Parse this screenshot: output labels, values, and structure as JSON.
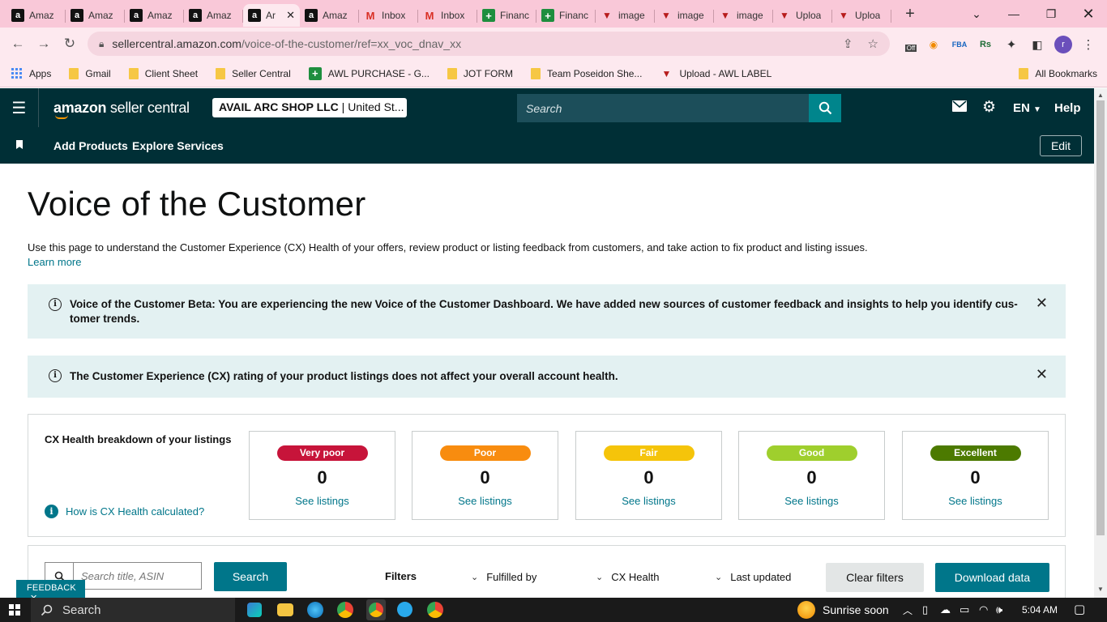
{
  "browser": {
    "tabs": [
      {
        "label": "Amaz",
        "icon": "amazon-icon"
      },
      {
        "label": "Amaz",
        "icon": "amazon-icon"
      },
      {
        "label": "Amaz",
        "icon": "amazon-icon"
      },
      {
        "label": "Amaz",
        "icon": "amazon-icon"
      },
      {
        "label": "Ar",
        "icon": "amazon-icon",
        "active": true
      },
      {
        "label": "Amaz",
        "icon": "amazon-icon"
      },
      {
        "label": "Inbox",
        "icon": "gmail-icon"
      },
      {
        "label": "Inbox",
        "icon": "gmail-icon"
      },
      {
        "label": "Financ",
        "icon": "sheets-icon"
      },
      {
        "label": "Financ",
        "icon": "sheets-icon"
      },
      {
        "label": "image",
        "icon": "triangle-app-icon"
      },
      {
        "label": "image",
        "icon": "triangle-app-icon"
      },
      {
        "label": "image",
        "icon": "triangle-app-icon"
      },
      {
        "label": "Uploa",
        "icon": "triangle-app-icon"
      },
      {
        "label": "Uploa",
        "icon": "triangle-app-icon"
      }
    ],
    "url_host": "sellercentral.amazon.com",
    "url_path": "/voice-of-the-customer/ref=xx_voc_dnav_xx",
    "bookmarks": [
      {
        "label": "Apps",
        "icon": "apps-grid-icon"
      },
      {
        "label": "Gmail",
        "icon": "folder-icon"
      },
      {
        "label": "Client Sheet",
        "icon": "folder-icon"
      },
      {
        "label": "Seller Central",
        "icon": "folder-icon"
      },
      {
        "label": "AWL PURCHASE - G...",
        "icon": "sheets-icon"
      },
      {
        "label": "JOT FORM",
        "icon": "folder-icon"
      },
      {
        "label": "Team Poseidon She...",
        "icon": "folder-icon"
      },
      {
        "label": "Upload - AWL LABEL",
        "icon": "triangle-app-icon"
      }
    ],
    "all_bookmarks": "All Bookmarks",
    "extension_off_badge": "Off",
    "profile_initial": "r"
  },
  "header": {
    "logo_bold": "amazon",
    "logo_light": " seller central",
    "account_name": "AVAIL ARC SHOP LLC",
    "account_region": " | United St...",
    "search_placeholder": "Search",
    "language": "EN",
    "help": "Help"
  },
  "nav": {
    "add_products": "Add Products",
    "explore_services": "Explore Services",
    "edit": "Edit"
  },
  "page": {
    "title": "Voice of the Customer",
    "description": "Use this page to understand the Customer Experience (CX) Health of your offers, review product or listing feedback from customers, and take action to fix product and listing issues.",
    "learn_more": "Learn more",
    "alert_beta": "Voice of the Customer Beta: You are experiencing the new Voice of the Customer Dashboard. We have added new sources of customer feedback and insights to help you identify cus- tomer trends.",
    "alert_rating": "The Customer Experience (CX) rating of your product listings does not affect your overall account health."
  },
  "cx": {
    "title": "CX Health breakdown of your listings",
    "help_link": "How is CX Health calculated?",
    "tiles": [
      {
        "label": "Very poor",
        "count": "0",
        "link": "See listings",
        "color": "#c7143a"
      },
      {
        "label": "Poor",
        "count": "0",
        "link": "See listings",
        "color": "#f88c0f"
      },
      {
        "label": "Fair",
        "count": "0",
        "link": "See listings",
        "color": "#f5c40a"
      },
      {
        "label": "Good",
        "count": "0",
        "link": "See listings",
        "color": "#9fcf2d"
      },
      {
        "label": "Excellent",
        "count": "0",
        "link": "See listings",
        "color": "#4c7a00"
      }
    ]
  },
  "filters": {
    "search_placeholder": "Search title, ASIN",
    "search_button": "Search",
    "label": "Filters",
    "fulfilled_by": "Fulfilled by",
    "cx_health": "CX Health",
    "last_updated": "Last updated",
    "clear": "Clear filters",
    "download": "Download data"
  },
  "feedback": "FEEDBACK",
  "taskbar": {
    "search": "Search",
    "weather": "Sunrise soon",
    "time": "5:04 AM"
  }
}
